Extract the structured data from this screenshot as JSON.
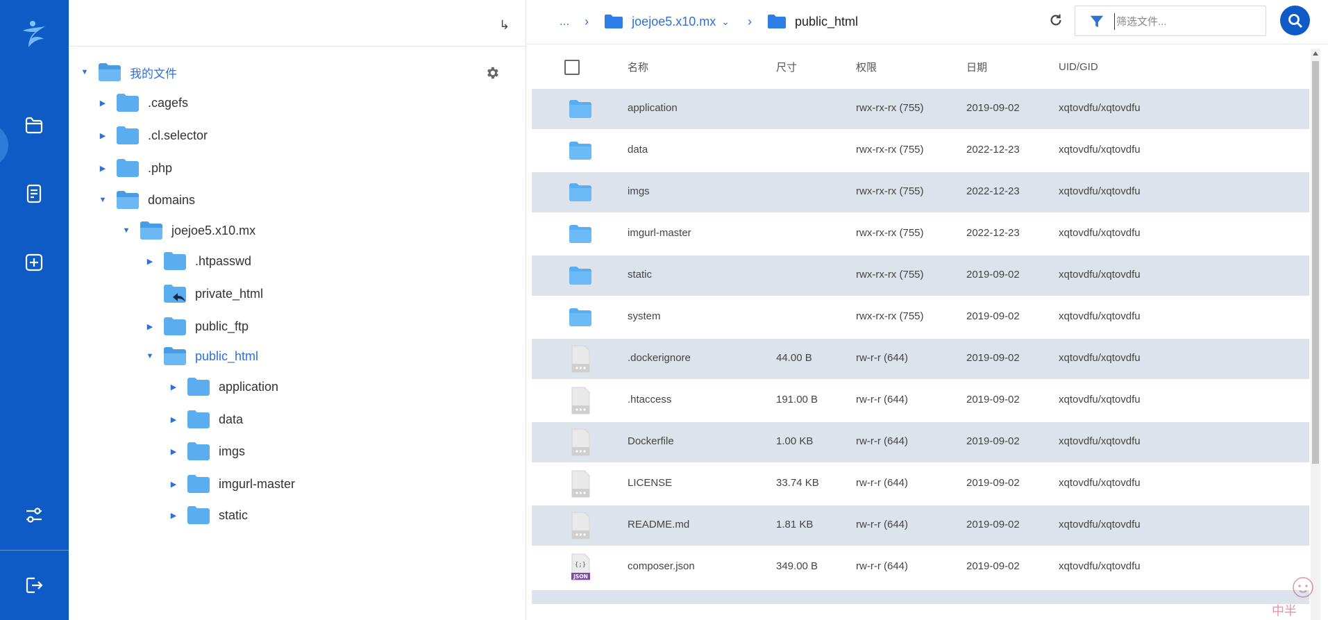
{
  "colors": {
    "rail": "#0f5bc6",
    "accent": "#2f6fd6",
    "row_alt": "#dde3ec",
    "folder": "#5aaef0"
  },
  "rail": {
    "items": [
      {
        "name": "folder-icon"
      },
      {
        "name": "document-icon"
      },
      {
        "name": "add-icon"
      },
      {
        "name": "sliders-icon"
      },
      {
        "name": "logout-icon"
      }
    ]
  },
  "tree": {
    "collapse_icon": "↳",
    "root_label": "我的文件",
    "nodes": [
      {
        "label": ".cagefs",
        "arrow": "▶",
        "icon": "folder"
      },
      {
        "label": ".cl.selector",
        "arrow": "▶",
        "icon": "folder"
      },
      {
        "label": ".php",
        "arrow": "▶",
        "icon": "folder"
      },
      {
        "label": "domains",
        "arrow": "▼",
        "icon": "folder-open"
      },
      {
        "label": "joejoe5.x10.mx",
        "arrow": "▼",
        "icon": "folder-open"
      },
      {
        "label": ".htpasswd",
        "arrow": "▶",
        "icon": "folder"
      },
      {
        "label": "private_html",
        "arrow": "",
        "icon": "folder-link"
      },
      {
        "label": "public_ftp",
        "arrow": "▶",
        "icon": "folder"
      },
      {
        "label": "public_html",
        "arrow": "▼",
        "icon": "folder-open"
      },
      {
        "label": "application",
        "arrow": "▶",
        "icon": "folder"
      },
      {
        "label": "data",
        "arrow": "▶",
        "icon": "folder"
      },
      {
        "label": "imgs",
        "arrow": "▶",
        "icon": "folder"
      },
      {
        "label": "imgurl-master",
        "arrow": "▶",
        "icon": "folder"
      },
      {
        "label": "static",
        "arrow": "▶",
        "icon": "folder"
      }
    ]
  },
  "breadcrumb": {
    "ellipsis": "...",
    "separator": "›",
    "parent": "joejoe5.x10.mx",
    "parent_caret": "⌄",
    "current": "public_html"
  },
  "filter": {
    "placeholder": "筛选文件..."
  },
  "table": {
    "headers": {
      "name": "名称",
      "size": "尺寸",
      "perm": "权限",
      "date": "日期",
      "uid": "UID/GID"
    },
    "rows": [
      {
        "type": "folder",
        "name": "application",
        "size": "",
        "perm": "rwx-rx-rx (755)",
        "date": "2019-09-02",
        "uid": "xqtovdfu/xqtovdfu"
      },
      {
        "type": "folder",
        "name": "data",
        "size": "",
        "perm": "rwx-rx-rx (755)",
        "date": "2022-12-23",
        "uid": "xqtovdfu/xqtovdfu"
      },
      {
        "type": "folder",
        "name": "imgs",
        "size": "",
        "perm": "rwx-rx-rx (755)",
        "date": "2022-12-23",
        "uid": "xqtovdfu/xqtovdfu"
      },
      {
        "type": "folder",
        "name": "imgurl-master",
        "size": "",
        "perm": "rwx-rx-rx (755)",
        "date": "2022-12-23",
        "uid": "xqtovdfu/xqtovdfu"
      },
      {
        "type": "folder",
        "name": "static",
        "size": "",
        "perm": "rwx-rx-rx (755)",
        "date": "2019-09-02",
        "uid": "xqtovdfu/xqtovdfu"
      },
      {
        "type": "folder",
        "name": "system",
        "size": "",
        "perm": "rwx-rx-rx (755)",
        "date": "2019-09-02",
        "uid": "xqtovdfu/xqtovdfu"
      },
      {
        "type": "file",
        "name": ".dockerignore",
        "size": "44.00 B",
        "perm": "rw-r-r (644)",
        "date": "2019-09-02",
        "uid": "xqtovdfu/xqtovdfu"
      },
      {
        "type": "file",
        "name": ".htaccess",
        "size": "191.00 B",
        "perm": "rw-r-r (644)",
        "date": "2019-09-02",
        "uid": "xqtovdfu/xqtovdfu"
      },
      {
        "type": "file",
        "name": "Dockerfile",
        "size": "1.00 KB",
        "perm": "rw-r-r (644)",
        "date": "2019-09-02",
        "uid": "xqtovdfu/xqtovdfu"
      },
      {
        "type": "file",
        "name": "LICENSE",
        "size": "33.74 KB",
        "perm": "rw-r-r (644)",
        "date": "2019-09-02",
        "uid": "xqtovdfu/xqtovdfu"
      },
      {
        "type": "file",
        "name": "README.md",
        "size": "1.81 KB",
        "perm": "rw-r-r (644)",
        "date": "2019-09-02",
        "uid": "xqtovdfu/xqtovdfu"
      },
      {
        "type": "json",
        "name": "composer.json",
        "size": "349.00 B",
        "perm": "rw-r-r (644)",
        "date": "2019-09-02",
        "uid": "xqtovdfu/xqtovdfu"
      }
    ]
  },
  "json_icon": {
    "glyph": "{;}",
    "badge": "JSON"
  },
  "watermark": {
    "text": "中半"
  }
}
